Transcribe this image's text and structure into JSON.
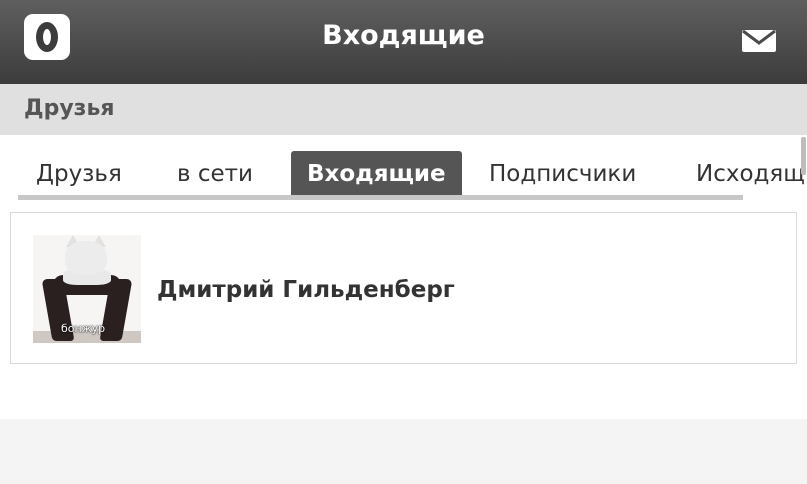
{
  "header": {
    "logo": "odnoklassniki-logo",
    "title": "Входящие",
    "mail_icon": "envelope-icon"
  },
  "section": {
    "title": "Друзья"
  },
  "tabs": [
    {
      "label": "Друзья",
      "active": false
    },
    {
      "label": "в сети",
      "active": false
    },
    {
      "label": "Входящие",
      "active": true
    },
    {
      "label": "Подписчики",
      "active": false
    },
    {
      "label": "Исходящ",
      "active": false
    }
  ],
  "requests": [
    {
      "name": "Дмитрий Гильденберг",
      "avatar_caption": "бонжур"
    }
  ],
  "colors": {
    "header_bg": "#4a4a4a",
    "section_bg": "#e0e0e0",
    "active_tab_bg": "#555555",
    "underline": "#c7c7c7"
  }
}
